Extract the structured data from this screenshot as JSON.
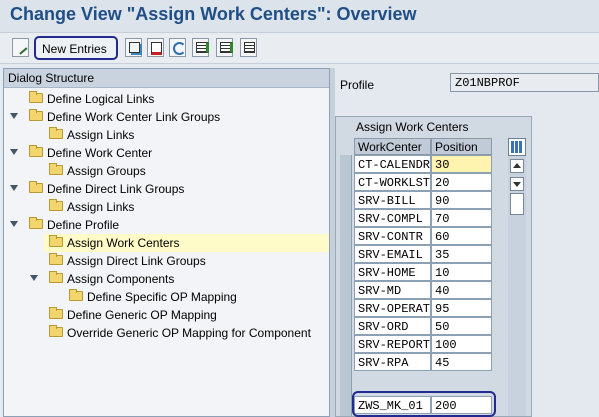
{
  "title": "Change View \"Assign Work Centers\": Overview",
  "toolbar": {
    "new_entries": "New Entries",
    "icons": [
      "edit-pencil-icon",
      "copy-icon",
      "delete-icon",
      "undo-icon",
      "select-all-icon",
      "select-block-icon",
      "deselect-all-icon"
    ]
  },
  "dialog": {
    "header": "Dialog Structure",
    "items": [
      {
        "label": "Define Logical Links",
        "level": 0,
        "expanded": false
      },
      {
        "label": "Define Work Center Link Groups",
        "level": 0,
        "expanded": true
      },
      {
        "label": "Assign Links",
        "level": 1,
        "expanded": false
      },
      {
        "label": "Define Work Center",
        "level": 0,
        "expanded": true
      },
      {
        "label": "Assign Groups",
        "level": 1,
        "expanded": false
      },
      {
        "label": "Define Direct Link Groups",
        "level": 0,
        "expanded": true
      },
      {
        "label": "Assign Links",
        "level": 1,
        "expanded": false
      },
      {
        "label": "Define Profile",
        "level": 0,
        "expanded": true
      },
      {
        "label": "Assign Work Centers",
        "level": 1,
        "expanded": false,
        "selected": true
      },
      {
        "label": "Assign Direct Link Groups",
        "level": 1,
        "expanded": false
      },
      {
        "label": "Assign Components",
        "level": 1,
        "expanded": true
      },
      {
        "label": "Define Specific OP Mapping",
        "level": 2,
        "expanded": false
      },
      {
        "label": "Define Generic OP Mapping",
        "level": 1,
        "expanded": false
      },
      {
        "label": "Override Generic OP Mapping for Component",
        "level": 1,
        "expanded": false
      }
    ]
  },
  "profile": {
    "label": "Profile",
    "value": "Z01NBPROF"
  },
  "table": {
    "caption": "Assign Work Centers",
    "columns": [
      "WorkCenter",
      "Position"
    ],
    "rows": [
      [
        "CT-CALENDR",
        "30"
      ],
      [
        "CT-WORKLST",
        "20"
      ],
      [
        "SRV-BILL",
        "90"
      ],
      [
        "SRV-COMPL",
        "70"
      ],
      [
        "SRV-CONTR",
        "60"
      ],
      [
        "SRV-EMAIL",
        "35"
      ],
      [
        "SRV-HOME",
        "10"
      ],
      [
        "SRV-MD",
        "40"
      ],
      [
        "SRV-OPERAT",
        "95"
      ],
      [
        "SRV-ORD",
        "50"
      ],
      [
        "SRV-REPORT",
        "100"
      ],
      [
        "SRV-RPA",
        "45"
      ],
      [
        "ZWS_MK_01",
        "200"
      ]
    ]
  },
  "colors": {
    "title": "#1f4f86",
    "highlight": "#222a8f",
    "selected_bg": "#fffbc8"
  }
}
